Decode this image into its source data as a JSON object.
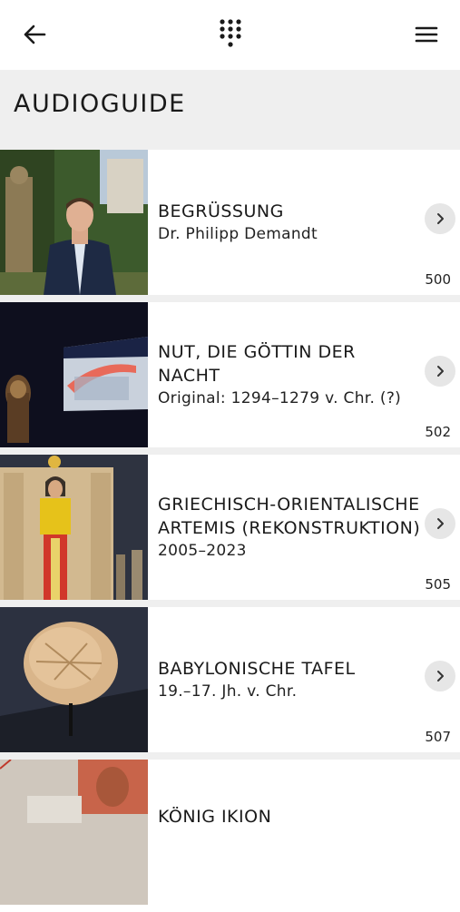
{
  "header": {
    "back_icon": "arrow-left-icon",
    "keypad_icon": "numeric-keypad-icon",
    "menu_icon": "hamburger-menu-icon"
  },
  "page": {
    "title": "AUDIOGUIDE"
  },
  "items": [
    {
      "title": "BEGRÜSSUNG",
      "subtitle": "Dr. Philipp Demandt",
      "number": "500"
    },
    {
      "title": "NUT, DIE GÖTTIN DER NACHT",
      "subtitle": "Original: 1294–1279 v. Chr. (?)",
      "number": "502"
    },
    {
      "title": "GRIECHISCH-ORIENTALISCHE ARTEMIS (REKONSTRUKTION)",
      "subtitle": "2005–2023",
      "number": "505"
    },
    {
      "title": "BABYLONISCHE TAFEL",
      "subtitle": "19.–17. Jh. v. Chr.",
      "number": "507"
    },
    {
      "title": "KÖNIG IKION",
      "subtitle": "",
      "number": ""
    }
  ],
  "colors": {
    "band": "#efefef",
    "chevron_bg": "#e6e6e6",
    "text": "#1a1a1a"
  }
}
